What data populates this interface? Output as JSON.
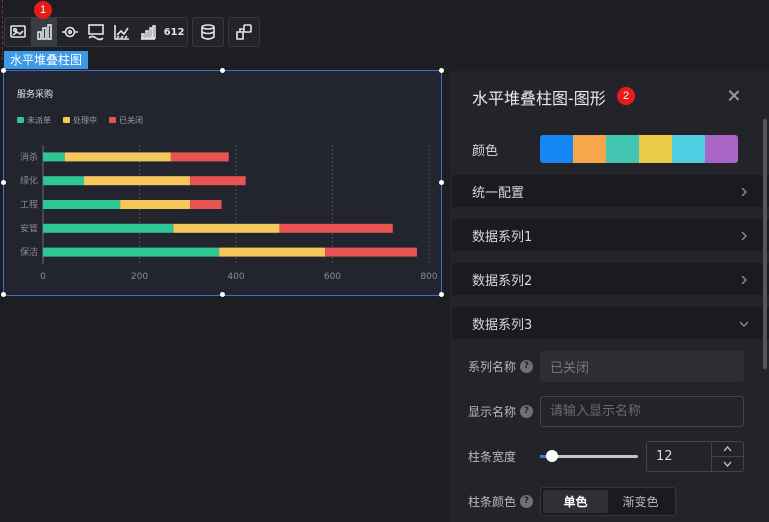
{
  "toolbar": {
    "badge": "1",
    "number_icon_text": "612",
    "buttons": [
      "image-chart-icon",
      "bar-chart-icon",
      "target-icon",
      "screen-icon",
      "trend-icon",
      "stepped-bar-icon",
      "number-icon",
      "database-icon",
      "share-icon"
    ]
  },
  "chart_tag": "水平堆叠柱图",
  "chart_data": {
    "type": "bar",
    "orientation": "horizontal",
    "stacked": true,
    "title": "服务采购",
    "categories": [
      "消杀",
      "绿化",
      "工程",
      "安管",
      "保洁"
    ],
    "series": [
      {
        "name": "未派单",
        "color": "#2ec794",
        "values": [
          45,
          85,
          160,
          270,
          365
        ]
      },
      {
        "name": "处理中",
        "color": "#f6c75a",
        "values": [
          220,
          220,
          145,
          220,
          220
        ]
      },
      {
        "name": "已关闭",
        "color": "#e85353",
        "values": [
          120,
          115,
          65,
          235,
          190
        ]
      }
    ],
    "x_ticks": [
      "0",
      "200",
      "400",
      "600",
      "800"
    ],
    "xlim": [
      0,
      800
    ],
    "grid": "vertical-dashed",
    "legend_position": "top-left"
  },
  "panel": {
    "title": "水平堆叠柱图-图形",
    "badge": "2",
    "color_label": "颜色",
    "colors": [
      "#1686f5",
      "#f8a64a",
      "#42c6b2",
      "#eccb49",
      "#4fcde1",
      "#a964c6"
    ],
    "sections": [
      "统一配置",
      "数据系列1",
      "数据系列2",
      "数据系列3"
    ],
    "series_name_label": "系列名称",
    "series_name_value": "已关闭",
    "display_name_label": "显示名称",
    "display_name_placeholder": "请输入显示名称",
    "bar_width_label": "柱条宽度",
    "bar_width_value": "12",
    "bar_color_label": "柱条颜色",
    "bar_color_options": [
      "单色",
      "渐变色"
    ],
    "bar_color_selected": "单色"
  }
}
